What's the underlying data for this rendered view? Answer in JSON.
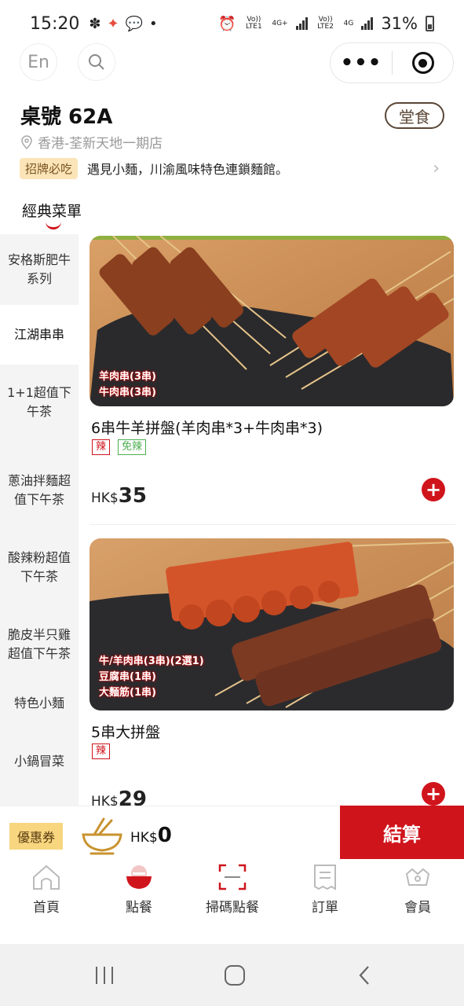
{
  "status_bar": {
    "time": "15:20",
    "net1": "Vo)) LTE1",
    "net1_type": "4G+",
    "net2": "Vo)) LTE2",
    "net2_type": "4G",
    "battery": "31%"
  },
  "top": {
    "lang_button": "En",
    "more_icon": "more-dots-icon",
    "record_icon": "target-icon"
  },
  "header": {
    "table_title": "桌號 62A",
    "dine_in": "堂食",
    "store": "香港-荃新天地一期店",
    "promo_badge": "招牌必吃",
    "promo_text": "遇見小麵，川渝風味特色連鎖麵館。"
  },
  "menu_tab": "經典菜單",
  "sidebar": {
    "items": [
      {
        "label": "安格斯肥牛系列"
      },
      {
        "label": "江湖串串"
      },
      {
        "label": "1+1超值下午茶"
      },
      {
        "label": "蔥油拌麵超值下午茶"
      },
      {
        "label": "酸辣粉超值下午茶"
      },
      {
        "label": "脆皮半只雞超值下午茶"
      },
      {
        "label": "特色小麵"
      },
      {
        "label": "小鍋冒菜"
      }
    ],
    "active_index": 1
  },
  "products": [
    {
      "image_labels": [
        "羊肉串(3串)",
        "牛肉串(3串)"
      ],
      "title": "6串牛羊拼盤(羊肉串*3+牛肉串*3)",
      "tags": [
        "辣",
        "免辣"
      ],
      "currency": "HK$",
      "price": "35"
    },
    {
      "image_labels": [
        "牛/羊肉串(3串)(2選1)",
        "豆腐串(1串)",
        "大麵筋(1串)"
      ],
      "title": "5串大拼盤",
      "tags": [
        "辣"
      ],
      "currency": "HK$",
      "price": "29"
    }
  ],
  "cart": {
    "coupon": "優惠券",
    "currency": "HK$",
    "total": "0",
    "checkout": "結算"
  },
  "bottom_nav": [
    {
      "label": "首頁",
      "icon": "home-icon"
    },
    {
      "label": "點餐",
      "icon": "rice-bowl-icon"
    },
    {
      "label": "掃碼點餐",
      "icon": "scan-icon"
    },
    {
      "label": "訂單",
      "icon": "receipt-icon"
    },
    {
      "label": "會員",
      "icon": "member-icon"
    }
  ],
  "colors": {
    "brand_red": "#d0141c",
    "coupon_yellow": "#f7d67f",
    "badge_bg": "#fbe5b8"
  }
}
